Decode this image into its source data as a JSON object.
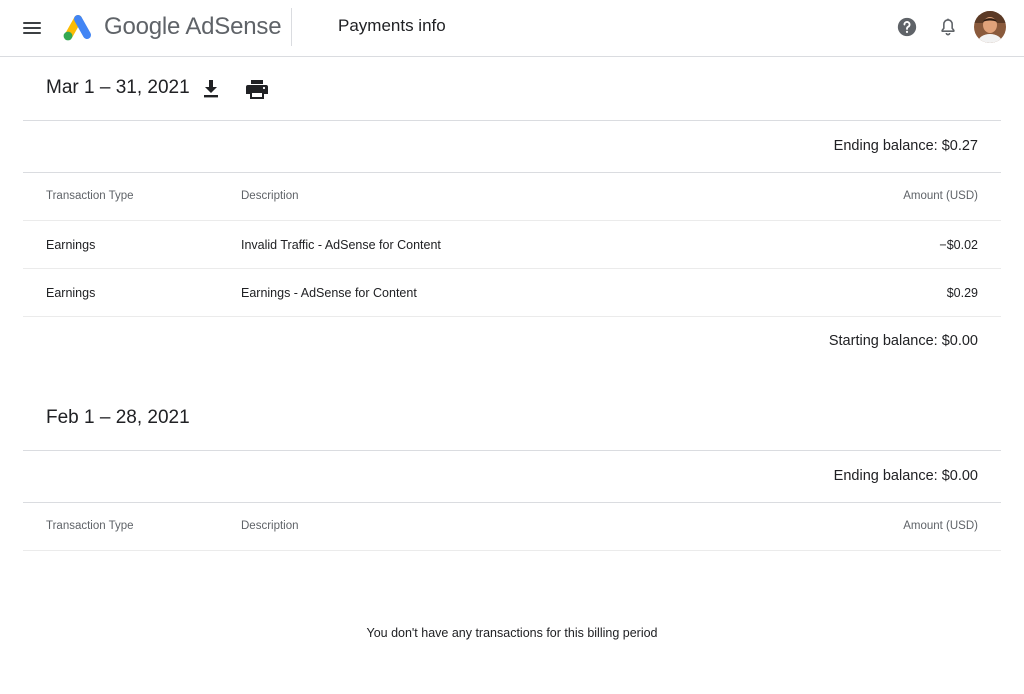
{
  "header": {
    "brand": "Google AdSense",
    "page_title": "Payments info",
    "icons": [
      "menu-icon",
      "adsense-logo",
      "help-icon",
      "bell-icon",
      "avatar"
    ]
  },
  "periods": [
    {
      "title": "Mar 1 – 31, 2021",
      "icons": [
        "download-icon",
        "print-icon"
      ],
      "ending_balance": "Ending balance: $0.27",
      "columns": {
        "type": "Transaction Type",
        "description": "Description",
        "amount": "Amount (USD)"
      },
      "rows": [
        {
          "type": "Earnings",
          "description": "Invalid Traffic - AdSense for Content",
          "amount": "−$0.02"
        },
        {
          "type": "Earnings",
          "description": "Earnings - AdSense for Content",
          "amount": "$0.29"
        }
      ],
      "starting_balance": "Starting balance: $0.00"
    },
    {
      "title": "Feb 1 – 28, 2021",
      "ending_balance": "Ending balance: $0.00",
      "columns": {
        "type": "Transaction Type",
        "description": "Description",
        "amount": "Amount (USD)"
      },
      "empty_message": "You don't have any transactions for this billing period"
    }
  ],
  "colors": {
    "logo_yellow": "#fbbc04",
    "logo_blue": "#4285f4",
    "logo_green": "#34a853",
    "divider": "#dadce0",
    "text_primary": "#202124",
    "text_secondary": "#5f6368"
  }
}
